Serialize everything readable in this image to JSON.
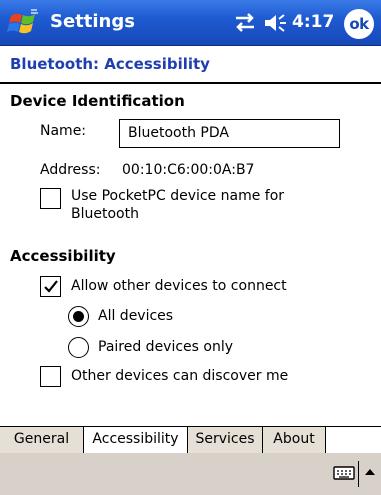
{
  "titlebar": {
    "title": "Settings",
    "time": "4:17",
    "ok_label": "ok",
    "start_icon": "windows-flag-icon",
    "connectivity_icon": "connectivity-arrows-icon",
    "volume_icon": "speaker-icon"
  },
  "page": {
    "title": "Bluetooth: Accessibility"
  },
  "device_identification": {
    "heading": "Device Identification",
    "name_label": "Name:",
    "name_value": "Bluetooth PDA",
    "address_label": "Address:",
    "address_value": "00:10:C6:00:0A:B7",
    "use_pocketpc_name_line1": "Use PocketPC device name for",
    "use_pocketpc_name_line2": "Bluetooth",
    "use_pocketpc_name_checked": false
  },
  "accessibility": {
    "heading": "Accessibility",
    "allow_connect_label": "Allow other devices to connect",
    "allow_connect_checked": true,
    "all_devices_label": "All devices",
    "paired_only_label": "Paired devices only",
    "selected_option": "All devices",
    "discoverable_label": "Other devices can discover me",
    "discoverable_checked": false
  },
  "tabs": [
    {
      "label": "General",
      "active": false
    },
    {
      "label": "Accessibility",
      "active": true
    },
    {
      "label": "Services",
      "active": false
    },
    {
      "label": "About",
      "active": false
    }
  ],
  "bottombar": {
    "keyboard_icon": "keyboard-icon",
    "sip_icon": "up-arrow-icon"
  },
  "colors": {
    "titlebar_blue": "#1e5bd1",
    "page_title_blue": "#1f3fb0",
    "tab_background": "#e6dfd6",
    "bottombar_background": "#d8d1c9"
  }
}
